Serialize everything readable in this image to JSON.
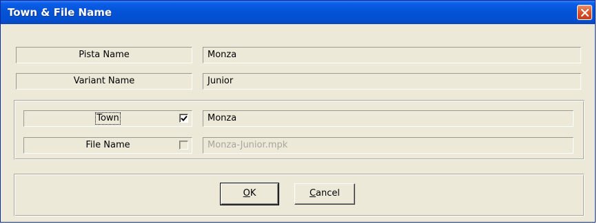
{
  "window": {
    "title": "Town & File Name"
  },
  "rows": {
    "pista_label": "Pista Name",
    "pista_value": "Monza",
    "variant_label": "Variant Name",
    "variant_value": "Junior"
  },
  "group": {
    "town_label": "Town",
    "town_checked": true,
    "town_value": "Monza",
    "file_label": "File Name",
    "file_checked": false,
    "file_value": "Monza-Junior.mpk"
  },
  "buttons": {
    "ok_label": "OK",
    "cancel_label": "Cancel"
  },
  "icons": {
    "close": "close-icon",
    "check": "checkmark-icon"
  }
}
